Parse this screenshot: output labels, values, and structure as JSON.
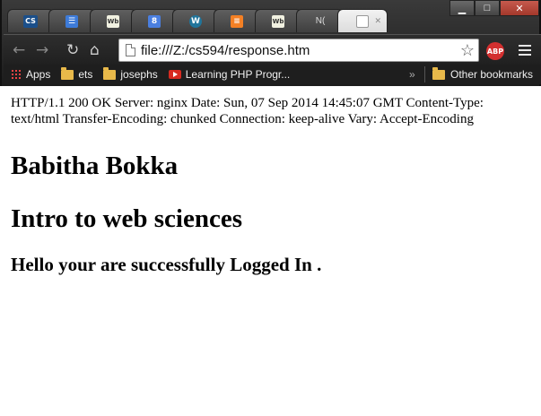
{
  "browser": {
    "tabs": [
      {
        "icon": "cs-icon",
        "glyph": "CS"
      },
      {
        "icon": "chat-icon",
        "glyph": "☰"
      },
      {
        "icon": "wb-icon",
        "glyph": "Wb"
      },
      {
        "icon": "google-icon",
        "glyph": "8"
      },
      {
        "icon": "wordpress-icon",
        "glyph": "W"
      },
      {
        "icon": "stackoverflow-icon",
        "glyph": "≡"
      },
      {
        "icon": "wb-icon",
        "glyph": "Wb"
      },
      {
        "icon": "new-tab-icon",
        "title": "N("
      },
      {
        "icon": "document-icon",
        "active": true
      }
    ],
    "url": "file:///Z:/cs594/response.htm",
    "extension_label": "ABP",
    "bookmarks": {
      "items": [
        "Apps",
        "ets",
        "josephs",
        "Learning PHP Progr..."
      ],
      "overflow": "»",
      "other": "Other bookmarks"
    }
  },
  "page": {
    "headers_text": "HTTP/1.1 200 OK Server: nginx Date: Sun, 07 Sep 2014 14:45:07 GMT Content-Type: text/html Transfer-Encoding: chunked Connection: keep-alive Vary: Accept-Encoding",
    "name": "Babitha Bokka",
    "course": "Intro to web sciences",
    "message": "Hello your are successfully Logged In ."
  }
}
